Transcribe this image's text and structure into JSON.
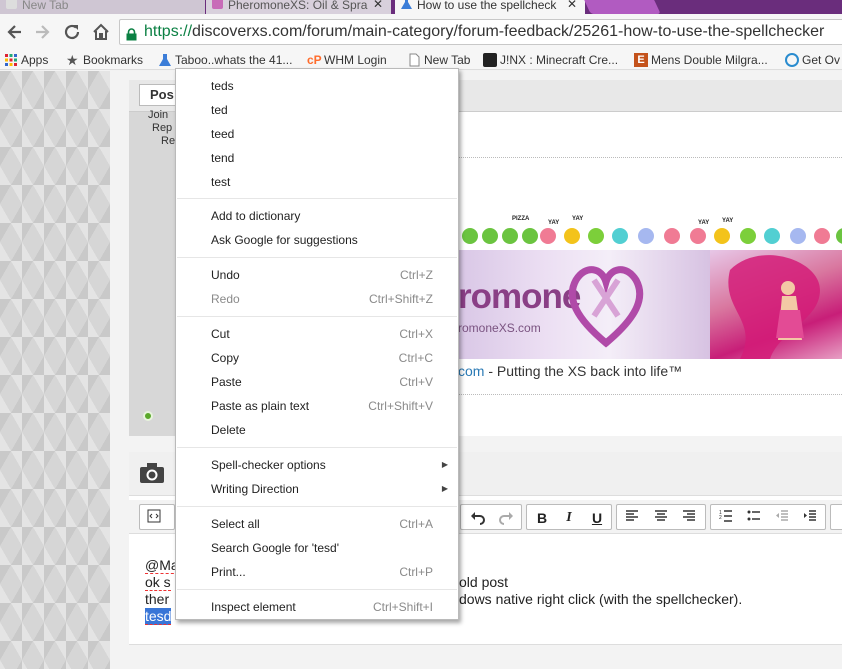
{
  "browser": {
    "tabs": [
      {
        "title": "New Tab"
      },
      {
        "title": "PheromoneXS: Oil & Spra"
      },
      {
        "title": "How to use the spellcheck"
      }
    ],
    "url_scheme": "https://",
    "url_rest": "discoverxs.com/forum/main-category/forum-feedback/25261-how-to-use-the-spellchecker",
    "bookmarks": [
      {
        "label": "Apps",
        "icon": "apps-grid-icon"
      },
      {
        "label": "Bookmarks",
        "icon": "star-icon"
      },
      {
        "label": "Taboo..whats the 41...",
        "icon": "flask-icon"
      },
      {
        "label": "WHM Login",
        "icon": "cpanel-icon"
      },
      {
        "label": "New Tab",
        "icon": "page-icon"
      },
      {
        "label": "J!NX : Minecraft Cre...",
        "icon": "jinx-icon"
      },
      {
        "label": "Mens Double Milgra...",
        "icon": "brand-e-icon"
      },
      {
        "label": "Get Ov",
        "icon": "circle-logo-icon"
      }
    ]
  },
  "post": {
    "button_label": "Pos",
    "side_lines": [
      "Join",
      "Rep",
      "Re"
    ],
    "smiley_tags": [
      "PIZZA",
      "YAY",
      "YAY",
      "YAY",
      "YAY"
    ],
    "banner_logo": "romone",
    "banner_sub": "romoneXS.com",
    "sig_link": "com",
    "sig_rest": " - Putting the XS back into life™"
  },
  "editor": {
    "lines": [
      {
        "left": "@Ma",
        "right": ""
      },
      {
        "left": "ok s",
        "right": "old post"
      },
      {
        "left": "ther",
        "right": "dows native right click (with the spellchecker)."
      },
      {
        "left": "tesd",
        "right": ""
      }
    ]
  },
  "context_menu": {
    "suggestions": [
      "teds",
      "ted",
      "teed",
      "tend",
      "test"
    ],
    "dictionary": [
      "Add to dictionary",
      "Ask Google for suggestions"
    ],
    "undo": {
      "label": "Undo",
      "shortcut": "Ctrl+Z"
    },
    "redo": {
      "label": "Redo",
      "shortcut": "Ctrl+Shift+Z"
    },
    "cut": {
      "label": "Cut",
      "shortcut": "Ctrl+X"
    },
    "copy": {
      "label": "Copy",
      "shortcut": "Ctrl+C"
    },
    "paste": {
      "label": "Paste",
      "shortcut": "Ctrl+V"
    },
    "paste_plain": {
      "label": "Paste as plain text",
      "shortcut": "Ctrl+Shift+V"
    },
    "delete": {
      "label": "Delete"
    },
    "spell_options": {
      "label": "Spell-checker options"
    },
    "writing_direction": {
      "label": "Writing Direction"
    },
    "select_all": {
      "label": "Select all",
      "shortcut": "Ctrl+A"
    },
    "search_google": {
      "label": "Search Google for 'tesd'"
    },
    "print": {
      "label": "Print...",
      "shortcut": "Ctrl+P"
    },
    "inspect": {
      "label": "Inspect element",
      "shortcut": "Ctrl+Shift+I"
    }
  },
  "colors": {
    "tab_strip": "#6a2d7c",
    "url_scheme": "#0b8043",
    "selection": "#3875d7",
    "link": "#2a7ab5"
  }
}
